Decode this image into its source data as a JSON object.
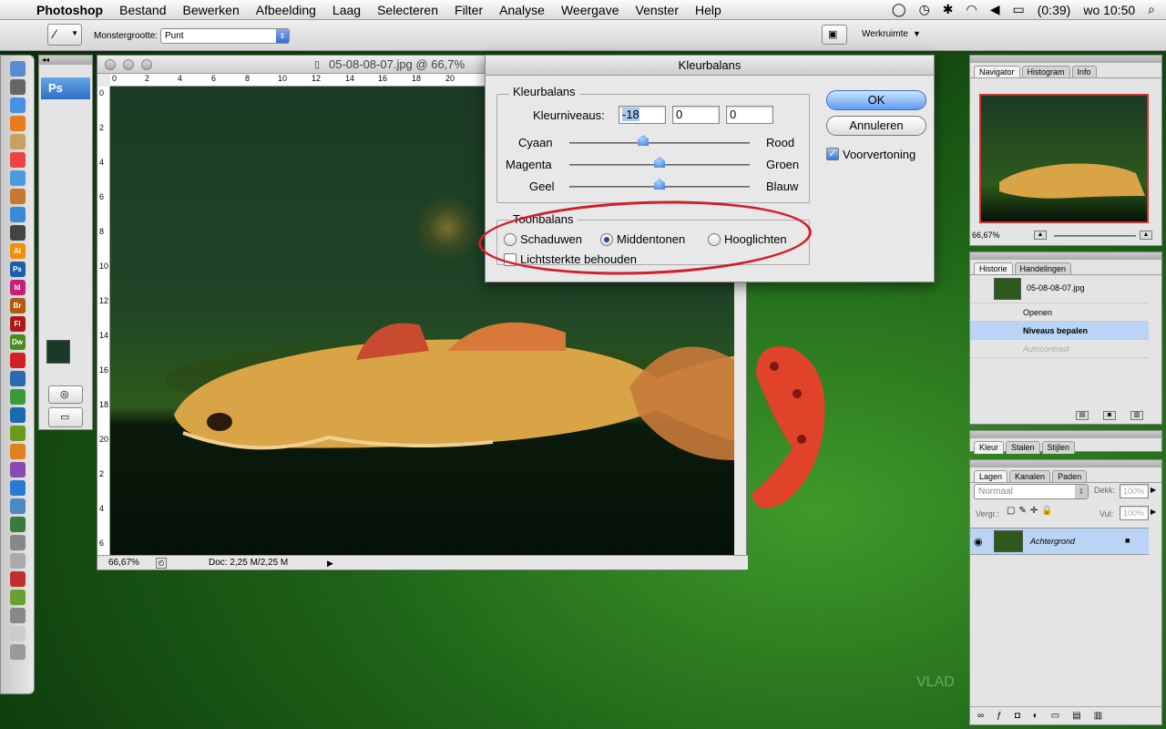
{
  "menubar": {
    "apple": "",
    "app": "Photoshop",
    "items": [
      "Bestand",
      "Bewerken",
      "Afbeelding",
      "Laag",
      "Selecteren",
      "Filter",
      "Analyse",
      "Weergave",
      "Venster",
      "Help"
    ],
    "battery": "(0:39)",
    "clock": "wo 10:50"
  },
  "options": {
    "sample_label": "Monstergrootte:",
    "sample_value": "Punt",
    "workspace": "Werkruimte"
  },
  "toolbox": {
    "logo": "Ps"
  },
  "document": {
    "title": "05-08-08-07.jpg @ 66,7%",
    "zoom": "66,67%",
    "doc_info": "Doc: 2,25 M/2,25 M",
    "ruler_top": [
      "0",
      "2",
      "4",
      "6",
      "8",
      "10",
      "12",
      "14",
      "16",
      "18",
      "20"
    ],
    "ruler_left": [
      "0",
      "2",
      "4",
      "6",
      "8",
      "10",
      "12",
      "14",
      "16",
      "18",
      "20",
      "2",
      "4",
      "6"
    ]
  },
  "dialog": {
    "title": "Kleurbalans",
    "group1": "Kleurbalans",
    "levels_label": "Kleurniveaus:",
    "level1": "-18",
    "level2": "0",
    "level3": "0",
    "sliders": [
      {
        "left": "Cyaan",
        "right": "Rood",
        "value": -18
      },
      {
        "left": "Magenta",
        "right": "Groen",
        "value": 0
      },
      {
        "left": "Geel",
        "right": "Blauw",
        "value": 0
      }
    ],
    "group2": "Toonbalans",
    "radio1": "Schaduwen",
    "radio2": "Middentonen",
    "radio3": "Hooglichten",
    "luminosity": "Lichtsterkte behouden",
    "ok": "OK",
    "cancel": "Annuleren",
    "preview": "Voorvertoning"
  },
  "navigator": {
    "tabs": [
      "Navigator",
      "Histogram",
      "Info"
    ],
    "zoom": "66,67%"
  },
  "history": {
    "tabs": [
      "Historie",
      "Handelingen"
    ],
    "snapshot": "05-08-08-07.jpg",
    "items": [
      "Openen",
      "Niveaus bepalen",
      "Autocontrast"
    ]
  },
  "color_panel": {
    "tabs": [
      "Kleur",
      "Stalen",
      "Stijlen"
    ]
  },
  "layers": {
    "tabs": [
      "Lagen",
      "Kanalen",
      "Paden"
    ],
    "blend": "Normaal",
    "opacity_label": "Dekk:",
    "opacity": "100%",
    "lock_label": "Vergr.:",
    "fill_label": "Vul:",
    "fill": "100%",
    "layer_name": "Achtergrond"
  },
  "watermark": "VLAD"
}
